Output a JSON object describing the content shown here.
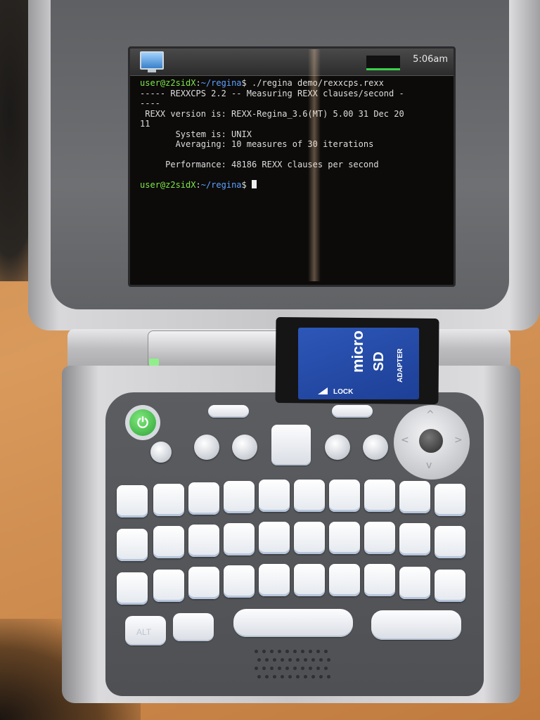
{
  "terminal": {
    "clock": "5:06am",
    "prompt_user": "user@z2sidX",
    "prompt_path": "~/regina",
    "prompt_sep": ":",
    "prompt_end": "$",
    "command": " ./regina demo/rexxcps.rexx",
    "lines": [
      "----- REXXCPS 2.2 -- Measuring REXX clauses/second -",
      "----",
      " REXX version is: REXX-Regina_3.6(MT) 5.00 31 Dec 20",
      "11",
      "       System is: UNIX",
      "       Averaging: 10 measures of 30 iterations",
      "",
      "     Performance: 48186 REXX clauses per second",
      ""
    ]
  },
  "sd_card": {
    "brand_micro": "micro",
    "brand_sd": "SD",
    "adapter": "ADAPTER",
    "lock": "LOCK"
  },
  "keyboard": {
    "alt_label": "ALT",
    "power_symbol": "⏻"
  },
  "colors": {
    "terminal_user": "#7ee64a",
    "terminal_path": "#5ea2ff",
    "sd_blue": "#2d57b8",
    "power_green": "#2fa33a"
  }
}
